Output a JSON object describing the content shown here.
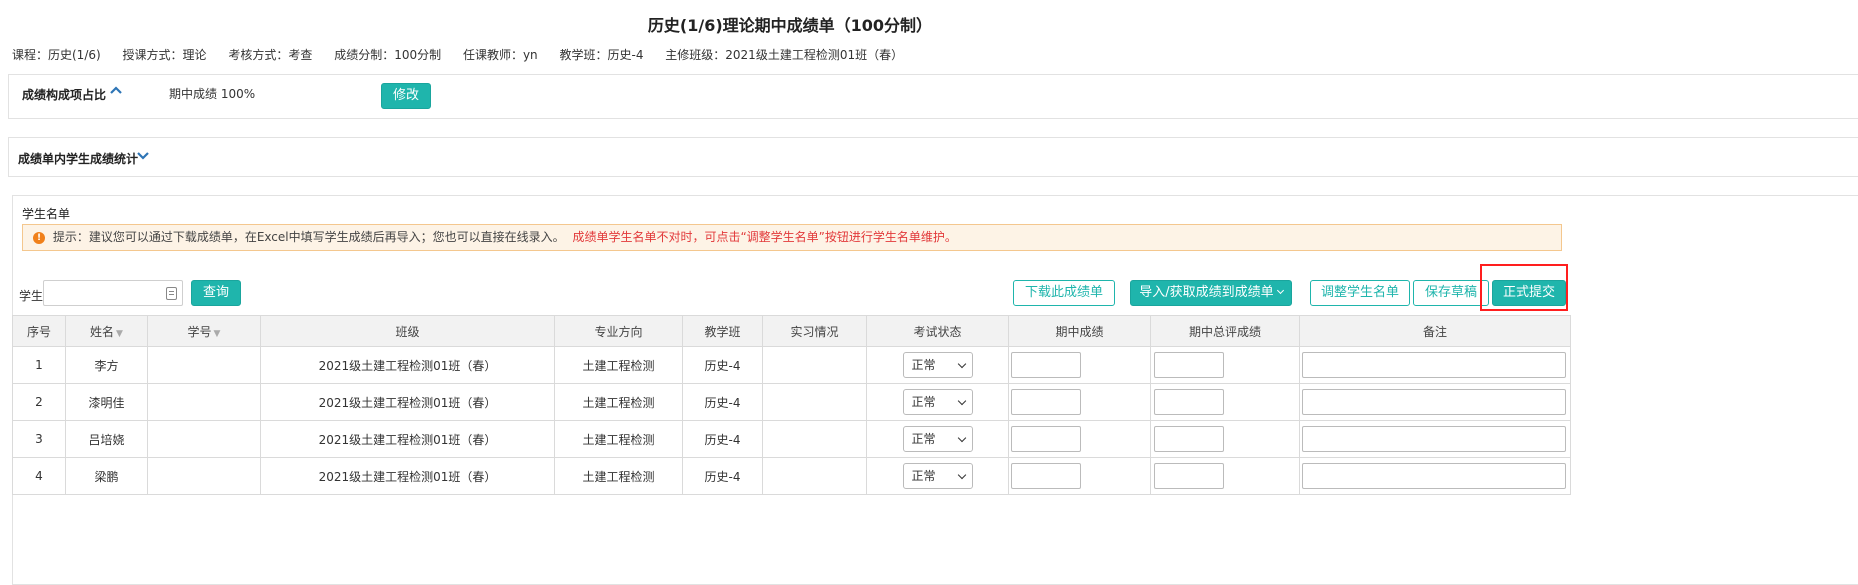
{
  "page_title": "历史(1/6)理论期中成绩单（100分制）",
  "info": {
    "course": "课程：历史(1/6)",
    "teach_mode": "授课方式：理论",
    "exam_mode": "考核方式：考查",
    "score_scale": "成绩分制：100分制",
    "teacher": "任课教师：yn",
    "class": "教学班：历史-4",
    "main_class": "主修班级：2021级土建工程检测01班（春）"
  },
  "composition": {
    "title": "成绩构成项占比",
    "text": "期中成绩 100%",
    "edit_label": "修改"
  },
  "stats": {
    "title": "成绩单内学生成绩统计"
  },
  "student_list": {
    "title": "学生名单",
    "tip_main": "提示：建议您可以通过下载成绩单，在Excel中填写学生成绩后再导入；您也可以直接在线录入。",
    "tip_warn": "成绩单学生名单不对时，可点击“调整学生名单”按钮进行学生名单维护。"
  },
  "toolbar": {
    "search_label": "学生",
    "search_placeholder": "",
    "query_label": "查询",
    "download_label": "下载此成绩单",
    "import_label": "导入/获取成绩到成绩单",
    "adjust_label": "调整学生名单",
    "save_label": "保存草稿",
    "submit_label": "正式提交"
  },
  "table": {
    "headers": [
      "序号",
      "姓名",
      "学号",
      "班级",
      "专业方向",
      "教学班",
      "实习情况",
      "考试状态",
      "期中成绩",
      "期中总评成绩",
      "备注"
    ],
    "rows": [
      {
        "no": "1",
        "name": "李方",
        "id": "",
        "class": "2021级土建工程检测01班（春）",
        "major": "土建工程检测",
        "tclass": "历史-4",
        "intern": "",
        "status": "正常"
      },
      {
        "no": "2",
        "name": "漆明佳",
        "id": "",
        "class": "2021级土建工程检测01班（春）",
        "major": "土建工程检测",
        "tclass": "历史-4",
        "intern": "",
        "status": "正常"
      },
      {
        "no": "3",
        "name": "吕培娆",
        "id": "",
        "class": "2021级土建工程检测01班（春）",
        "major": "土建工程检测",
        "tclass": "历史-4",
        "intern": "",
        "status": "正常"
      },
      {
        "no": "4",
        "name": "梁鹏",
        "id": "",
        "class": "2021级土建工程检测01班（春）",
        "major": "土建工程检测",
        "tclass": "历史-4",
        "intern": "",
        "status": "正常"
      }
    ]
  },
  "colors": {
    "accent": "#1fb5ac",
    "warn": "#e2393a",
    "highlight": "#ff1e1e",
    "chevron": "#2e75b6"
  }
}
